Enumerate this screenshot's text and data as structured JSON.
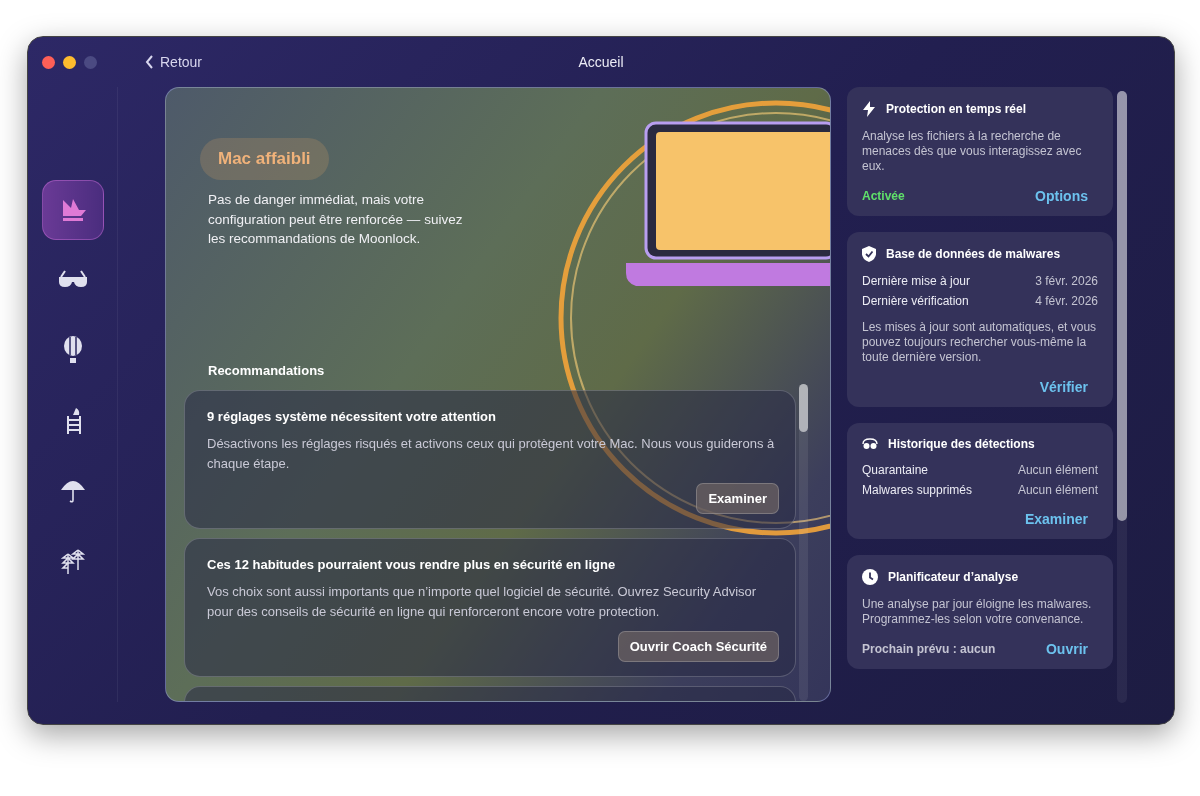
{
  "window": {
    "title": "Accueil",
    "back": "Retour"
  },
  "sidebar": {
    "items": [
      {
        "kind": "home",
        "selected": true
      },
      {
        "kind": "glasses",
        "selected": false
      },
      {
        "kind": "balloon",
        "selected": false
      },
      {
        "kind": "ladder",
        "selected": false
      },
      {
        "kind": "umbrella",
        "selected": false
      },
      {
        "kind": "leaves",
        "selected": false
      }
    ]
  },
  "hero": {
    "status": "Mac affaibli",
    "description": "Pas de danger immédiat, mais votre configuration peut être renforcée — suivez les recommandations de Moonlock."
  },
  "recommendations": {
    "heading": "Recommandations",
    "items": [
      {
        "title": "9 réglages système nécessitent votre attention",
        "text": "Désactivons les réglages risqués et activons ceux qui protègent votre Mac. Nous vous guiderons à chaque étape.",
        "button": "Examiner"
      },
      {
        "title": "Ces 12 habitudes pourraient vous rendre plus en sécurité en ligne",
        "text": "Vos choix sont aussi importants que n’importe quel logiciel de sécurité. Ouvrez Security Advisor pour des conseils de sécurité en ligne qui renforceront encore votre protection.",
        "button": "Ouvrir Coach Sécurité"
      }
    ]
  },
  "panels": [
    {
      "kind": "bolt",
      "title": "Protection en temps réel",
      "text": "Analyse les fichiers à la recherche de menaces dès que vous interagissez avec eux.",
      "status": "Activée",
      "action": "Options"
    },
    {
      "kind": "shield",
      "title": "Base de données de malwares",
      "rows": [
        {
          "label": "Dernière mise à jour",
          "value": "3 févr. 2026"
        },
        {
          "label": "Dernière vérification",
          "value": "4 févr. 2026"
        }
      ],
      "text": "Les mises à jour sont automatiques, et vous pouvez toujours rechercher vous-même la toute dernière version.",
      "action": "Vérifier"
    },
    {
      "kind": "glasses",
      "title": "Historique des détections",
      "rows": [
        {
          "label": "Quarantaine",
          "value": "Aucun élément"
        },
        {
          "label": "Malwares supprimés",
          "value": "Aucun élément"
        }
      ],
      "action": "Examiner"
    },
    {
      "kind": "clock",
      "title": "Planificateur d’analyse",
      "text": "Une analyse par jour éloigne les malwares. Programmez-les selon votre convenance.",
      "note": "Prochain prévu : aucun",
      "action": "Ouvrir"
    }
  ]
}
